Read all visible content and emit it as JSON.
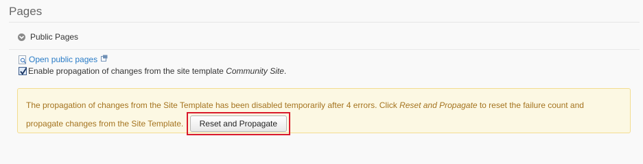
{
  "section": {
    "title": "Pages"
  },
  "panel": {
    "header": "Public Pages"
  },
  "links": {
    "open_public_pages": "Open public pages"
  },
  "propagation": {
    "label_before": "Enable propagation of changes from the site template ",
    "site_name": "Community Site",
    "label_after": ".",
    "checked": true
  },
  "alert": {
    "text_part1": "The propagation of changes from the Site Template has been disabled temporarily after 4 errors. Click ",
    "text_emphasis": "Reset and Propagate",
    "text_part2": " to reset the failure count and propagate changes from the Site Template.",
    "button_label": "Reset and Propagate"
  },
  "colors": {
    "link": "#2a7cc7",
    "alert_bg": "#fcf8e3",
    "alert_border": "#f3dc8f",
    "alert_text": "#a4731e",
    "highlight": "#d9182a"
  },
  "icons": {
    "panel_toggle": "chevron-down-icon",
    "page": "page-icon",
    "external": "external-link-icon",
    "check": "checkmark-icon"
  }
}
